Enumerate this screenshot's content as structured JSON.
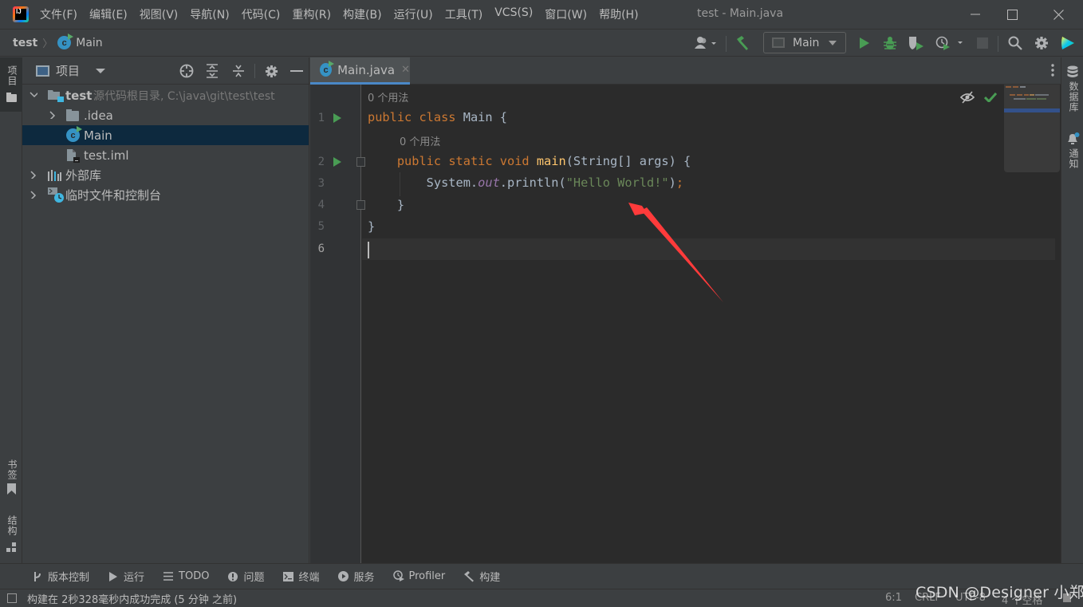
{
  "window": {
    "title": "test - Main.java",
    "menu": [
      "文件(F)",
      "编辑(E)",
      "视图(V)",
      "导航(N)",
      "代码(C)",
      "重构(R)",
      "构建(B)",
      "运行(U)",
      "工具(T)",
      "VCS(S)",
      "窗口(W)",
      "帮助(H)"
    ],
    "controls": {
      "minimize": "—",
      "maximize": "☐",
      "close": "✕"
    }
  },
  "navbar": {
    "breadcrumb": {
      "project": "test",
      "file": "Main"
    },
    "run_config": "Main",
    "icons": [
      "user-icon",
      "build-hammer-icon",
      "run-icon",
      "debug-icon",
      "coverage-icon",
      "profile-icon",
      "stop-icon",
      "search-icon",
      "settings-icon",
      "toolbox-icon"
    ]
  },
  "left_stripe": {
    "project_label": "项目",
    "bookmarks_label": "书签",
    "structure_label": "结构"
  },
  "project_panel": {
    "title": "项目",
    "tree": [
      {
        "name": "test",
        "hint": "源代码根目录, C:\\java\\git\\test\\test",
        "type": "module",
        "expanded": true,
        "level": 0
      },
      {
        "name": ".idea",
        "type": "folder",
        "expanded": false,
        "level": 1
      },
      {
        "name": "Main",
        "type": "class",
        "level": 1,
        "selected": true
      },
      {
        "name": "test.iml",
        "type": "iml",
        "level": 1
      },
      {
        "name": "外部库",
        "type": "libraries",
        "expanded": false,
        "level": 0
      },
      {
        "name": "临时文件和控制台",
        "type": "scratches",
        "expanded": false,
        "level": 0
      }
    ]
  },
  "editor": {
    "tab": {
      "label": "Main.java",
      "close": "✕"
    },
    "usage_hint": "0 个用法",
    "lines": [
      {
        "num": "1",
        "tokens": [
          {
            "t": "public ",
            "c": "kw"
          },
          {
            "t": "class ",
            "c": "kw"
          },
          {
            "t": "Main {",
            "c": ""
          }
        ]
      },
      {
        "num": "2",
        "tokens": [
          {
            "t": "    public ",
            "c": "kw"
          },
          {
            "t": "static ",
            "c": "kw"
          },
          {
            "t": "void ",
            "c": "kw"
          },
          {
            "t": "main",
            "c": "fn"
          },
          {
            "t": "(String[] args) {",
            "c": ""
          }
        ]
      },
      {
        "num": "3",
        "tokens": [
          {
            "t": "        System.",
            "c": ""
          },
          {
            "t": "out",
            "c": "stat"
          },
          {
            "t": ".println(",
            "c": ""
          },
          {
            "t": "\"Hello World!\"",
            "c": "str"
          },
          {
            "t": ")",
            "c": ""
          },
          {
            "t": ";",
            "c": "kw"
          }
        ]
      },
      {
        "num": "4",
        "tokens": [
          {
            "t": "    }",
            "c": ""
          }
        ]
      },
      {
        "num": "5",
        "tokens": [
          {
            "t": "}",
            "c": ""
          }
        ]
      },
      {
        "num": "6",
        "tokens": []
      }
    ]
  },
  "right_stripe": {
    "database_label": "数据库",
    "notifications_label": "通知"
  },
  "bottom_tools": [
    {
      "label": "版本控制",
      "icon": "vcs-icon"
    },
    {
      "label": "运行",
      "icon": "run-icon"
    },
    {
      "label": "TODO",
      "icon": "todo-icon"
    },
    {
      "label": "问题",
      "icon": "problems-icon"
    },
    {
      "label": "终端",
      "icon": "terminal-icon"
    },
    {
      "label": "服务",
      "icon": "services-icon"
    },
    {
      "label": "Profiler",
      "icon": "profiler-icon"
    },
    {
      "label": "构建",
      "icon": "build-icon"
    }
  ],
  "status": {
    "message": "构建在 2秒328毫秒内成功完成 (5 分钟 之前)",
    "position": "6:1",
    "line_sep": "CRLF",
    "encoding": "UTF-8",
    "indent": "4 个空格"
  },
  "watermark": "CSDN @Designer 小郑",
  "colors": {
    "accent": "#4a88c7",
    "selection": "#0d293e",
    "keyword": "#cc7832",
    "string": "#6a8759",
    "function": "#ffc66d",
    "run_green": "#499c54",
    "annotation_arrow": "#ff3b3b"
  }
}
